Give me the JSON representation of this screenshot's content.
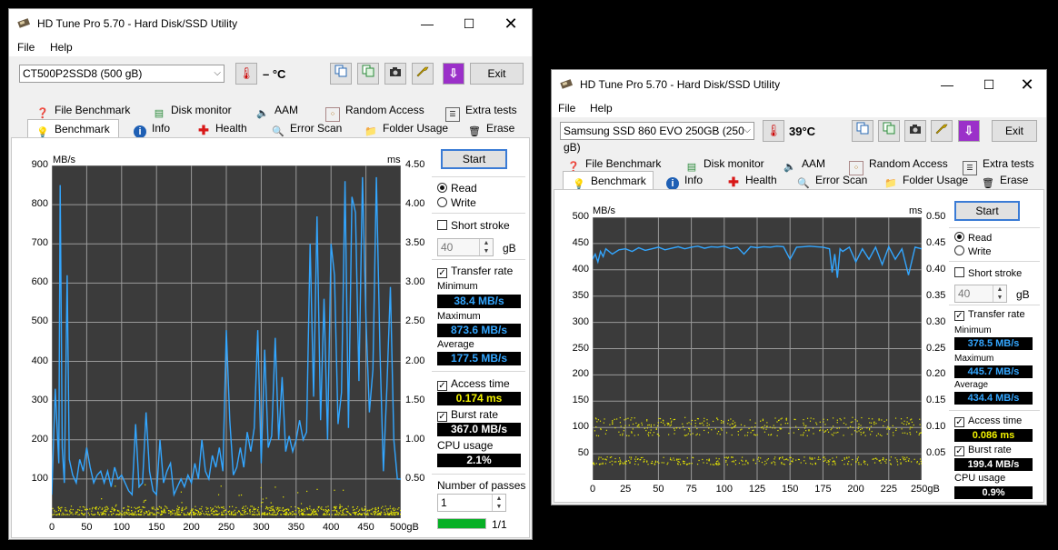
{
  "windows": [
    {
      "id": "w1",
      "title": "HD Tune Pro 5.70 - Hard Disk/SSD Utility",
      "menu": [
        "File",
        "Help"
      ],
      "drive": "CT500P2SSD8 (500 gB)",
      "temperature": "– °C",
      "exit_label": "Exit",
      "tabs_top": [
        "File Benchmark",
        "Disk monitor",
        "AAM",
        "Random Access",
        "Extra tests"
      ],
      "tabs_bottom": [
        "Benchmark",
        "Info",
        "Health",
        "Error Scan",
        "Folder Usage",
        "Erase"
      ],
      "active_tab": "Benchmark",
      "start_label": "Start",
      "read_label": "Read",
      "write_label": "Write",
      "short_stroke_label": "Short stroke",
      "short_stroke_value": "40",
      "short_stroke_unit": "gB",
      "transfer_rate_label": "Transfer rate",
      "minimum_label": "Minimum",
      "minimum_value": "38.4 MB/s",
      "maximum_label": "Maximum",
      "maximum_value": "873.6 MB/s",
      "average_label": "Average",
      "average_value": "177.5 MB/s",
      "access_time_label": "Access time",
      "access_time_value": "0.174 ms",
      "burst_rate_label": "Burst rate",
      "burst_rate_value": "367.0 MB/s",
      "cpu_label": "CPU usage",
      "cpu_value": "2.1%",
      "passes_label": "Number of passes",
      "passes_value": "1",
      "progress_text": "1/1",
      "progress_fraction": 1.0
    },
    {
      "id": "w2",
      "title": "HD Tune Pro 5.70 - Hard Disk/SSD Utility",
      "menu": [
        "File",
        "Help"
      ],
      "drive": "Samsung SSD 860 EVO 250GB (250 gB)",
      "temperature": "39°C",
      "exit_label": "Exit",
      "tabs_top": [
        "File Benchmark",
        "Disk monitor",
        "AAM",
        "Random Access",
        "Extra tests"
      ],
      "tabs_bottom": [
        "Benchmark",
        "Info",
        "Health",
        "Error Scan",
        "Folder Usage",
        "Erase"
      ],
      "active_tab": "Benchmark",
      "start_label": "Start",
      "read_label": "Read",
      "write_label": "Write",
      "short_stroke_label": "Short stroke",
      "short_stroke_value": "40",
      "short_stroke_unit": "gB",
      "transfer_rate_label": "Transfer rate",
      "minimum_label": "Minimum",
      "minimum_value": "378.5 MB/s",
      "maximum_label": "Maximum",
      "maximum_value": "445.7 MB/s",
      "average_label": "Average",
      "average_value": "434.4 MB/s",
      "access_time_label": "Access time",
      "access_time_value": "0.086 ms",
      "burst_rate_label": "Burst rate",
      "burst_rate_value": "199.4 MB/s",
      "cpu_label": "CPU usage",
      "cpu_value": "0.9%"
    }
  ],
  "chart_data": [
    {
      "type": "line",
      "ylabel": "MB/s",
      "y2label": "ms",
      "xlim": [
        0,
        500
      ],
      "ylim": [
        0,
        900
      ],
      "y2lim": [
        0,
        4.5
      ],
      "x_ticks": [
        "0",
        "50",
        "100",
        "150",
        "200",
        "250",
        "300",
        "350",
        "400",
        "450",
        "500gB"
      ],
      "y_ticks": [
        "900",
        "800",
        "700",
        "600",
        "500",
        "400",
        "300",
        "200",
        "100"
      ],
      "y2_ticks": [
        "4.50",
        "4.00",
        "3.50",
        "3.00",
        "2.50",
        "2.00",
        "1.50",
        "1.00",
        "0.50"
      ],
      "grid": true,
      "series": [
        {
          "name": "Transfer rate",
          "color": "#33a6ff",
          "x": [
            0,
            5,
            10,
            12,
            15,
            18,
            22,
            25,
            30,
            35,
            40,
            45,
            50,
            55,
            60,
            65,
            70,
            75,
            80,
            85,
            90,
            95,
            100,
            105,
            110,
            115,
            120,
            125,
            130,
            135,
            140,
            145,
            150,
            155,
            160,
            165,
            170,
            175,
            180,
            185,
            190,
            195,
            200,
            205,
            210,
            215,
            220,
            225,
            230,
            235,
            240,
            245,
            250,
            255,
            260,
            265,
            270,
            275,
            280,
            285,
            290,
            295,
            300,
            305,
            310,
            315,
            320,
            325,
            330,
            335,
            340,
            345,
            350,
            355,
            360,
            365,
            370,
            375,
            380,
            385,
            390,
            395,
            400,
            405,
            410,
            415,
            420,
            425,
            430,
            435,
            440,
            445,
            450,
            455,
            460,
            465,
            470,
            475,
            480,
            485,
            490,
            495,
            500
          ],
          "values": [
            60,
            330,
            140,
            850,
            180,
            90,
            620,
            150,
            110,
            90,
            150,
            120,
            180,
            130,
            90,
            110,
            120,
            90,
            120,
            80,
            130,
            100,
            110,
            90,
            70,
            60,
            240,
            80,
            90,
            270,
            120,
            70,
            60,
            200,
            90,
            120,
            140,
            60,
            80,
            100,
            80,
            110,
            90,
            140,
            100,
            200,
            120,
            100,
            160,
            130,
            180,
            120,
            480,
            250,
            110,
            130,
            180,
            130,
            220,
            170,
            230,
            480,
            140,
            430,
            180,
            210,
            460,
            200,
            360,
            170,
            210,
            170,
            200,
            250,
            200,
            220,
            700,
            310,
            770,
            250,
            560,
            200,
            700,
            620,
            240,
            320,
            860,
            230,
            820,
            780,
            350,
            870,
            510,
            270,
            380,
            870,
            430,
            120,
            330,
            590,
            200,
            100,
            100
          ]
        },
        {
          "name": "Access time",
          "color": "#e8e800",
          "points_count": 900,
          "ms_range": [
            0.05,
            0.45
          ]
        }
      ]
    },
    {
      "type": "line",
      "ylabel": "MB/s",
      "y2label": "ms",
      "xlim": [
        0,
        250
      ],
      "ylim": [
        0,
        500
      ],
      "y2lim": [
        0,
        0.5
      ],
      "x_ticks": [
        "0",
        "25",
        "50",
        "75",
        "100",
        "125",
        "150",
        "175",
        "200",
        "225",
        "250gB"
      ],
      "y_ticks": [
        "500",
        "450",
        "400",
        "350",
        "300",
        "250",
        "200",
        "150",
        "100",
        "50"
      ],
      "y2_ticks": [
        "0.50",
        "0.45",
        "0.40",
        "0.35",
        "0.30",
        "0.25",
        "0.20",
        "0.15",
        "0.10",
        "0.05"
      ],
      "grid": true,
      "series": [
        {
          "name": "Transfer rate",
          "color": "#33a6ff",
          "x": [
            0,
            2,
            4,
            6,
            8,
            10,
            15,
            20,
            25,
            30,
            35,
            40,
            45,
            50,
            55,
            60,
            65,
            70,
            75,
            80,
            85,
            90,
            95,
            100,
            105,
            110,
            115,
            120,
            125,
            130,
            135,
            140,
            145,
            150,
            155,
            160,
            165,
            170,
            175,
            180,
            182,
            184,
            186,
            188,
            190,
            195,
            200,
            205,
            210,
            215,
            220,
            225,
            230,
            235,
            240,
            245,
            250
          ],
          "values": [
            420,
            430,
            415,
            435,
            425,
            440,
            430,
            438,
            440,
            435,
            442,
            437,
            440,
            443,
            438,
            441,
            444,
            440,
            443,
            445,
            441,
            444,
            443,
            445,
            440,
            443,
            430,
            444,
            442,
            444,
            443,
            445,
            444,
            420,
            443,
            444,
            445,
            444,
            443,
            440,
            395,
            430,
            385,
            440,
            435,
            443,
            415,
            440,
            420,
            443,
            410,
            444,
            420,
            440,
            390,
            443,
            440
          ]
        },
        {
          "name": "Access time",
          "color": "#e8e800",
          "points_count": 700,
          "ms_range": [
            0.03,
            0.12
          ]
        }
      ]
    }
  ]
}
